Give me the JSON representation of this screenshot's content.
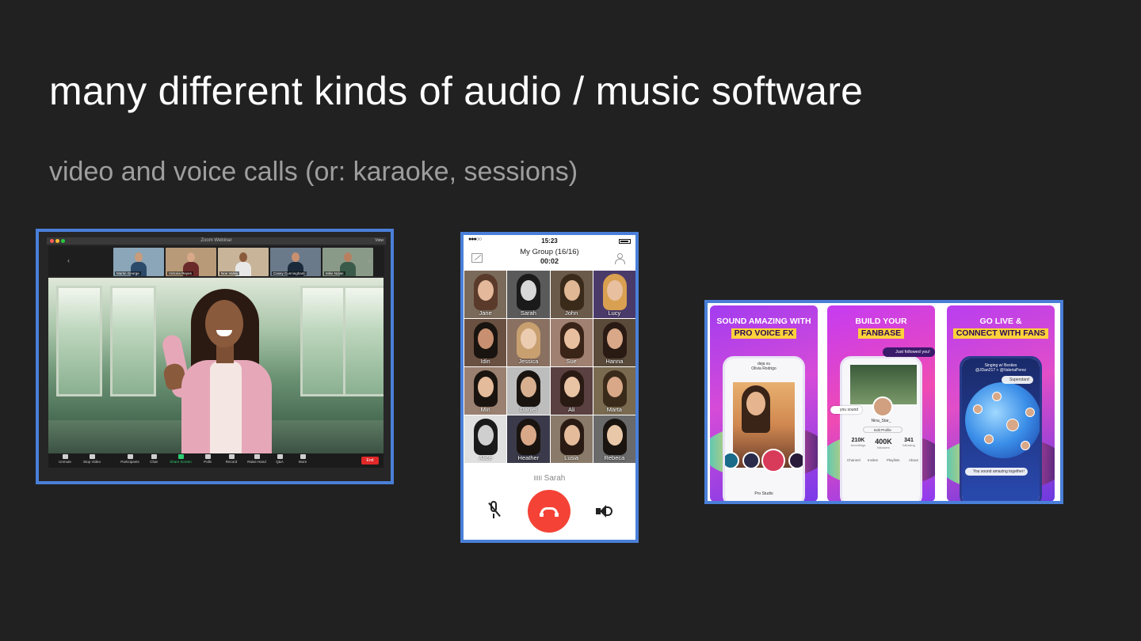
{
  "slide": {
    "title": "many different kinds of audio / music software",
    "subtitle": "video and voice calls (or: karaoke, sessions)"
  },
  "zoom": {
    "window_title": "Zoom Webinar",
    "view_label": "View",
    "thumbnails": [
      {
        "name": "Martin George",
        "bg": "#8aa6b8",
        "skin": "#c89c7c",
        "shirt": "#2c4a6a"
      },
      {
        "name": "Victoria Reyes",
        "bg": "#b89a78",
        "skin": "#d8a888",
        "shirt": "#6a2a2a"
      },
      {
        "name": "Noe Valley",
        "bg": "#c8b498",
        "skin": "#8a5a3c",
        "shirt": "#e8e8e8"
      },
      {
        "name": "Casey Cunningham",
        "bg": "#6a7a8a",
        "skin": "#c89070",
        "shirt": "#1a2a3a"
      },
      {
        "name": "Mike Nolan",
        "bg": "#8a9a88",
        "skin": "#b88060",
        "shirt": "#3a5a4a"
      }
    ],
    "toolbar": [
      {
        "label": "Unmute",
        "icon": "microphone-icon"
      },
      {
        "label": "Stop Video",
        "icon": "video-camera-icon"
      },
      {
        "label": "Participants",
        "icon": "participants-icon"
      },
      {
        "label": "Chat",
        "icon": "chat-icon"
      },
      {
        "label": "Share Screen",
        "icon": "share-screen-icon"
      },
      {
        "label": "Polls",
        "icon": "polls-icon"
      },
      {
        "label": "Record",
        "icon": "record-icon"
      },
      {
        "label": "Raise Hand",
        "icon": "raise-hand-icon"
      },
      {
        "label": "Q&A",
        "icon": "qa-icon"
      },
      {
        "label": "More",
        "icon": "more-icon"
      }
    ],
    "end_label": "End",
    "share_color": "#2ecc71",
    "end_color": "#e02828"
  },
  "phone": {
    "status_time": "15:23",
    "signal": "●●●○○",
    "group_title": "My Group (16/16)",
    "timer": "00:02",
    "participants": [
      {
        "name": "Jane",
        "hair": "#5a3a2a",
        "skin": "#e4b89a",
        "bg": "#7a6a5a"
      },
      {
        "name": "Sarah",
        "hair": "#1a1a1a",
        "skin": "#d8d8d8",
        "bg": "#5a5a5a"
      },
      {
        "name": "John",
        "hair": "#3a2a1a",
        "skin": "#e0b896",
        "bg": "#6a5a4a"
      },
      {
        "name": "Lucy",
        "hair": "#d8a050",
        "skin": "#e8c0a0",
        "bg": "#4a3a6a"
      },
      {
        "name": "Idin",
        "hair": "#1a1410",
        "skin": "#c89070",
        "bg": "#6a5040"
      },
      {
        "name": "Jessica",
        "hair": "#c8a070",
        "skin": "#ecccb0",
        "bg": "#8a7060"
      },
      {
        "name": "Sue",
        "hair": "#3a2418",
        "skin": "#e8c0a0",
        "bg": "#a08070"
      },
      {
        "name": "Hanna",
        "hair": "#2a1a14",
        "skin": "#d8a888",
        "bg": "#5a4a3a"
      },
      {
        "name": "Min",
        "hair": "#1a1410",
        "skin": "#e4bc9c",
        "bg": "#9a8070"
      },
      {
        "name": "Daniel",
        "hair": "#1a1410",
        "skin": "#d8b090",
        "bg": "#bdbdbd"
      },
      {
        "name": "Ali",
        "hair": "#2a1a14",
        "skin": "#e8c4a4",
        "bg": "#5a4040"
      },
      {
        "name": "Marta",
        "hair": "#3a2a1a",
        "skin": "#d8a888",
        "bg": "#7a6a50"
      },
      {
        "name": "Alice",
        "hair": "#1a1a1a",
        "skin": "#cfcfcf",
        "bg": "#e0e0e0"
      },
      {
        "name": "Heather",
        "hair": "#1a1410",
        "skin": "#d8a888",
        "bg": "#3a3a4a"
      },
      {
        "name": "Lusia",
        "hair": "#2a1a14",
        "skin": "#e4bc9c",
        "bg": "#8a7a6a"
      },
      {
        "name": "Rebeca",
        "hair": "#1a1410",
        "skin": "#e8c8a8",
        "bg": "#6a6a6a"
      }
    ],
    "caller": "Sarah",
    "hangup_color": "#f44336"
  },
  "store": {
    "cards": [
      {
        "line1": "SOUND AMAZING WITH",
        "highlight": "PRO VOICE FX"
      },
      {
        "line1": "BUILD YOUR",
        "highlight": "FANBASE"
      },
      {
        "line1": "GO LIVE &",
        "highlight": "CONNECT WITH FANS"
      }
    ],
    "card1": {
      "song_title": "deja vu",
      "song_artist": "Olivia Rodrigo",
      "fx_label": "Pro Studio"
    },
    "card2": {
      "followed_text": "Just followed you!",
      "sound_text": "you sound",
      "profile_name": "Nina_Star_",
      "edit_label": "Edit Profile",
      "stats": [
        {
          "value": "210K",
          "label": "recordings"
        },
        {
          "value": "400K",
          "label": "followers"
        },
        {
          "value": "341",
          "label": "following"
        }
      ],
      "tabs": [
        "Channel",
        "Invites",
        "Playlists",
        "About"
      ]
    },
    "card3": {
      "live_title": "Singing w/ Besties",
      "live_host": "@JDan217 + @ValeriaPerez",
      "superstars": "Superstars!",
      "comment": "You sound amazing together!"
    },
    "highlight_color": "#ffd23a"
  }
}
